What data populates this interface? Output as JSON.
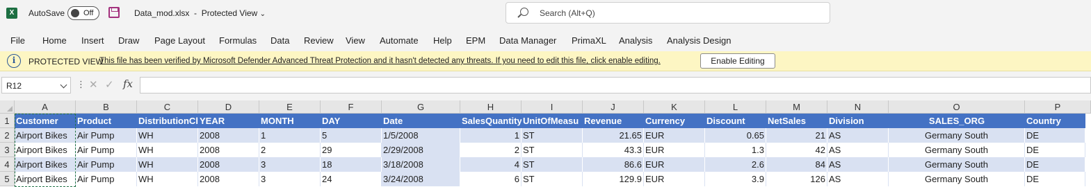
{
  "titlebar": {
    "app_icon": "X",
    "autosave_label": "AutoSave",
    "autosave_state": "Off",
    "filename": "Data_mod.xlsx",
    "mode": "Protected View",
    "search_placeholder": "Search (Alt+Q)"
  },
  "menu": [
    "File",
    "Home",
    "Insert",
    "Draw",
    "Page Layout",
    "Formulas",
    "Data",
    "Review",
    "View",
    "Automate",
    "Help",
    "EPM",
    "Data Manager",
    "PrimaXL",
    "Analysis",
    "Analysis Design"
  ],
  "protected_view": {
    "title": "PROTECTED VIEW",
    "message": "This file has been verified by Microsoft Defender Advanced Threat Protection and it hasn't detected any threats. If you need to edit this file, click enable editing.",
    "button": "Enable Editing"
  },
  "formula_bar": {
    "name_box": "R12",
    "fx": "fx",
    "value": ""
  },
  "columns": [
    "A",
    "B",
    "C",
    "D",
    "E",
    "F",
    "G",
    "H",
    "I",
    "J",
    "K",
    "L",
    "M",
    "N",
    "O",
    "P"
  ],
  "rows": [
    "1",
    "2",
    "3",
    "4",
    "5"
  ],
  "header_row": [
    "Customer",
    "Product",
    "DistributionCl",
    "YEAR",
    "MONTH",
    "DAY",
    "Date",
    "SalesQuantity",
    "UnitOfMeasu",
    "Revenue",
    "Currency",
    "Discount",
    "NetSales",
    "Division",
    "SALES_ORG",
    "Country"
  ],
  "data_rows": [
    [
      "Airport Bikes",
      "Air Pump",
      "WH",
      "2008",
      "1",
      "5",
      "1/5/2008",
      "1",
      "ST",
      "21.65",
      "EUR",
      "0.65",
      "21",
      "AS",
      "Germany South",
      "DE"
    ],
    [
      "Airport Bikes",
      "Air Pump",
      "WH",
      "2008",
      "2",
      "29",
      "2/29/2008",
      "2",
      "ST",
      "43.3",
      "EUR",
      "1.3",
      "42",
      "AS",
      "Germany South",
      "DE"
    ],
    [
      "Airport Bikes",
      "Air Pump",
      "WH",
      "2008",
      "3",
      "18",
      "3/18/2008",
      "4",
      "ST",
      "86.6",
      "EUR",
      "2.6",
      "84",
      "AS",
      "Germany South",
      "DE"
    ],
    [
      "Airport Bikes",
      "Air Pump",
      "WH",
      "2008",
      "3",
      "24",
      "3/24/2008",
      "6",
      "ST",
      "129.9",
      "EUR",
      "3.9",
      "126",
      "AS",
      "Germany South",
      "DE"
    ]
  ],
  "colors": {
    "header_fill": "#4472c4",
    "band_fill": "#d9e1f2",
    "protected_bar": "#fdf6c3",
    "excel_green": "#1d6f42"
  }
}
